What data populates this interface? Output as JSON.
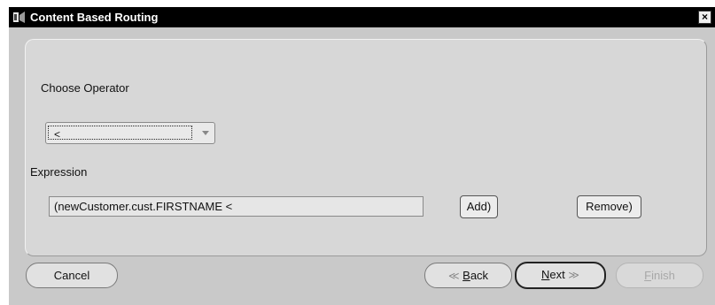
{
  "window": {
    "title": "Content Based Routing",
    "close_label": "×"
  },
  "operator": {
    "label": "Choose Operator",
    "selected": "<"
  },
  "expression": {
    "label": "Expression",
    "value": "(newCustomer.cust.FIRSTNAME <"
  },
  "actions": {
    "add_label": "Add)",
    "remove_label": "Remove)"
  },
  "footer": {
    "cancel_label": "Cancel",
    "back_mnemonic": "B",
    "back_rest": "ack",
    "next_mnemonic": "N",
    "next_rest": "ext",
    "finish_mnemonic": "F",
    "finish_rest": "inish",
    "back_chevron": "≪",
    "next_chevron": "≫"
  },
  "icons": {
    "app": "window-app-icon",
    "close": "close-icon",
    "dropdown": "chevron-down-icon"
  }
}
